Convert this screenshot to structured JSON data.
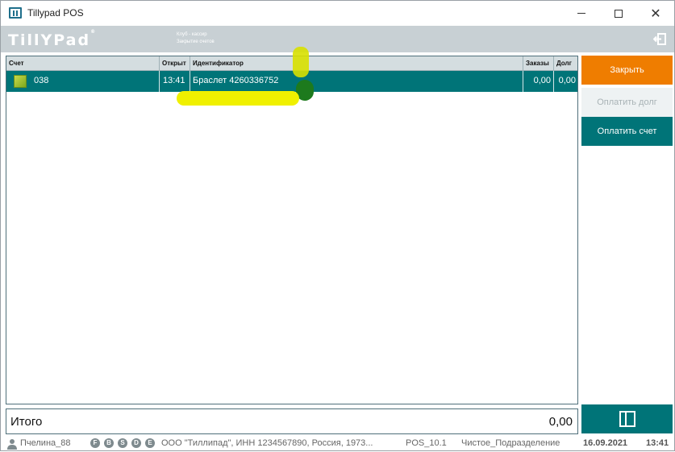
{
  "window": {
    "title": "Tillypad POS"
  },
  "topbar": {
    "logo": "TillYPad",
    "context_line1": "Клуб - кассир",
    "context_line2": "Закрытие счетов"
  },
  "grid": {
    "columns": [
      "Счет",
      "Открыт",
      "Идентификатор",
      "Заказы",
      "Долг"
    ],
    "rows": [
      {
        "account": "038",
        "opened": "13:41",
        "identifier": "Браслет 4260336752",
        "orders": "0,00",
        "debt": "0,00"
      }
    ]
  },
  "actions": {
    "close": "Закрыть",
    "pay_debt": "Оплатить долг",
    "pay_bill": "Оплатить счет"
  },
  "total": {
    "label": "Итого",
    "value": "0,00"
  },
  "statusbar": {
    "user": "Пчелина_88",
    "badges": [
      "F",
      "B",
      "S",
      "D",
      "E"
    ],
    "company": "ООО \"Тиллипад\", ИНН 1234567890, Россия, 1973...",
    "terminal": "POS_10.1",
    "division": "Чистое_Подразделение",
    "date": "16.09.2021",
    "time": "13:41"
  },
  "colors": {
    "accent": "#007478",
    "close_button": "#ef7d00",
    "highlight": "#f0f000"
  }
}
